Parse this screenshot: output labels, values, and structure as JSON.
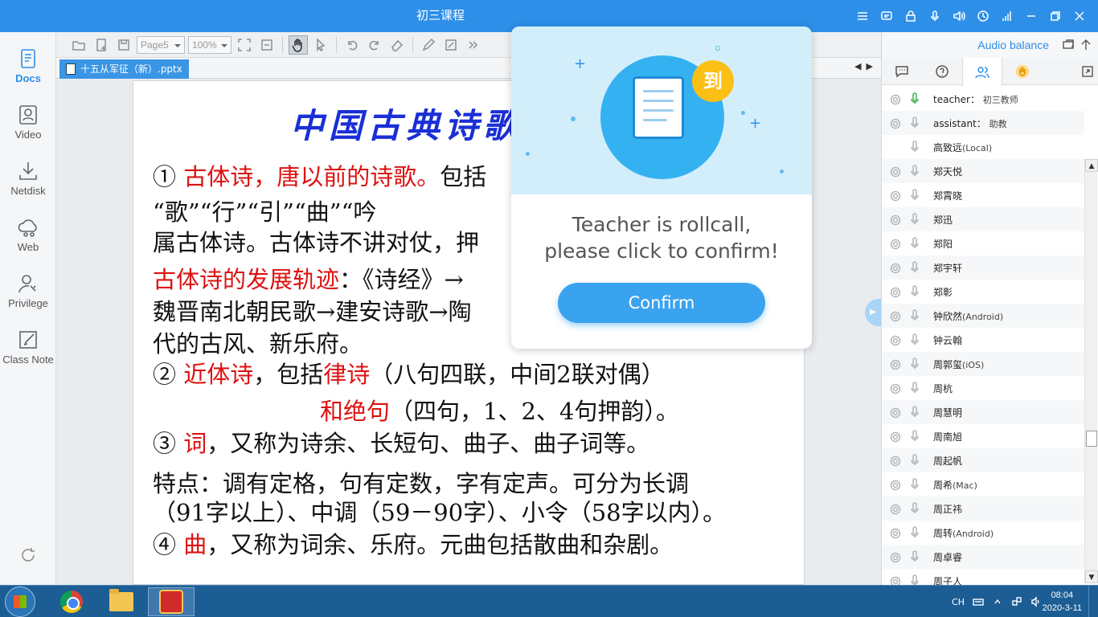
{
  "window": {
    "title": "初三课程"
  },
  "sidebar": {
    "items": [
      {
        "label": "Docs",
        "icon": "document-icon",
        "active": true
      },
      {
        "label": "Video",
        "icon": "video-icon"
      },
      {
        "label": "Netdisk",
        "icon": "download-icon"
      },
      {
        "label": "Web",
        "icon": "web-icon"
      },
      {
        "label": "Privilege",
        "icon": "privilege-icon"
      },
      {
        "label": "Class Note",
        "icon": "note-icon"
      }
    ]
  },
  "toolbar": {
    "page_select": "Page5",
    "zoom_select": "100%"
  },
  "document": {
    "tab_label": "十五从军征（新）.pptx"
  },
  "slide": {
    "heading": "中国古典诗歌",
    "lines": [
      {
        "num": "①",
        "red": "古体诗，唐以前的诗歌。",
        "rest": "包括"
      },
      {
        "text": "“歌”“行”“引”“曲”“吟"
      },
      {
        "text": "属古体诗。古体诗不讲对仗，押"
      },
      {
        "red": "古体诗的发展轨迹",
        "rest": "：《诗经》→"
      },
      {
        "text": "魏晋南北朝民歌→建安诗歌→陶"
      },
      {
        "text": "代的古风、新乐府。"
      },
      {
        "num": "②",
        "red": "近体诗",
        "mid": "，包括",
        "red2": "律诗",
        "rest": "（八句四联，中间2联对偶）"
      },
      {
        "red": "和绝句",
        "rest": "（四句，1、2、4句押韵）。"
      },
      {
        "num": "③",
        "red": "词",
        "rest": "，又称为诗余、长短句、曲子、曲子词等。"
      },
      {
        "text": "特点：调有定格，句有定数，字有定声。可分为长调"
      },
      {
        "text": "（91字以上）、中调（59－90字）、小令（58字以内）。"
      },
      {
        "num": "④",
        "red": "曲",
        "rest": "，又称为词余、乐府。元曲包括散曲和杂剧。"
      }
    ]
  },
  "rightpanel": {
    "audio_balance": "Audio balance",
    "users": [
      {
        "name": "teacher：",
        "extra": "初三教师",
        "mic_active": true,
        "cam": true
      },
      {
        "name": "assistant：",
        "extra": "助教",
        "cam": true
      },
      {
        "name": "高致远",
        "extra": "(Local)",
        "cam": false
      },
      {
        "name": "郑天悦",
        "cam": true
      },
      {
        "name": "郑霄晓",
        "cam": true
      },
      {
        "name": "郑迅",
        "cam": true
      },
      {
        "name": "郑阳",
        "cam": true
      },
      {
        "name": "郑宇轩",
        "cam": true
      },
      {
        "name": "郑彰",
        "cam": true
      },
      {
        "name": "钟欣然",
        "extra": "(Android)",
        "cam": true
      },
      {
        "name": "钟云翰",
        "cam": true
      },
      {
        "name": "周郭玺",
        "extra": "(iOS)",
        "cam": true
      },
      {
        "name": "周杭",
        "cam": true
      },
      {
        "name": "周慧明",
        "cam": true
      },
      {
        "name": "周南旭",
        "cam": true
      },
      {
        "name": "周起帆",
        "cam": true
      },
      {
        "name": "周希",
        "extra": "(Mac)",
        "cam": true
      },
      {
        "name": "周正祎",
        "cam": true
      },
      {
        "name": "周转",
        "extra": "(Android)",
        "cam": true
      },
      {
        "name": "周卓睿",
        "cam": true
      },
      {
        "name": "周子人",
        "cam": true
      }
    ]
  },
  "rollcall": {
    "badge": "到",
    "message_line1": "Teacher is rollcall,",
    "message_line2": "please click to confirm!",
    "confirm_label": "Confirm"
  },
  "taskbar": {
    "lang": "CH",
    "time": "08:04",
    "date": "2020-3-11"
  },
  "colors": {
    "accent": "#2d8fe8",
    "slide_heading": "#1a2fd6",
    "slide_red": "#dd1111",
    "badge": "#fbbf16"
  }
}
